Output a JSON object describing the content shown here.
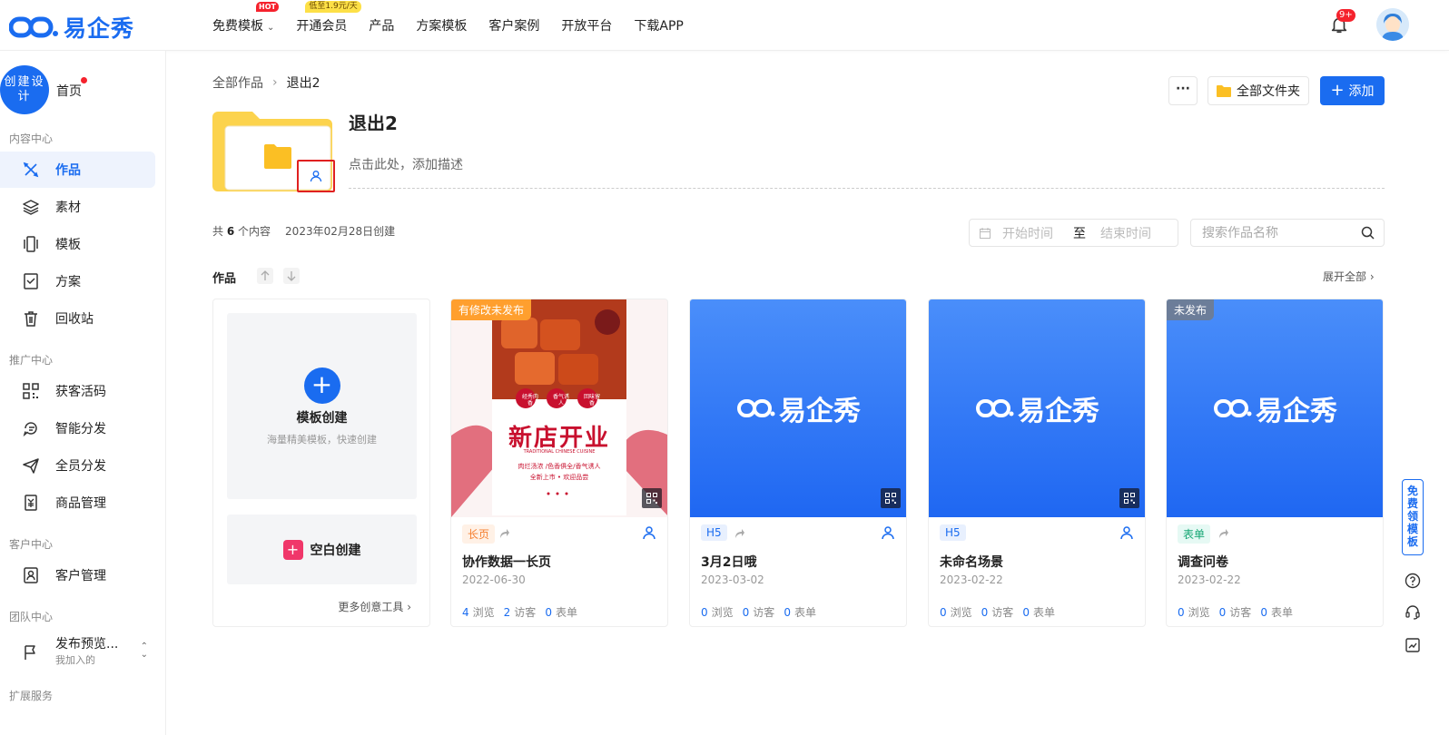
{
  "app": {
    "logo_text": "易企秀"
  },
  "nav": {
    "items": [
      {
        "label": "免费模板",
        "badge": "HOT"
      },
      {
        "label": "开通会员",
        "badge": "低至1.9元/天"
      },
      {
        "label": "产品"
      },
      {
        "label": "方案模板"
      },
      {
        "label": "客户案例"
      },
      {
        "label": "开放平台"
      },
      {
        "label": "下载APP"
      }
    ],
    "notification_count": "9+"
  },
  "sidebar": {
    "create_label": "创建设计",
    "home_label": "首页",
    "groups": [
      {
        "title": "内容中心"
      },
      {
        "title": "推广中心"
      },
      {
        "title": "客户中心"
      },
      {
        "title": "团队中心"
      },
      {
        "title": "扩展服务"
      }
    ],
    "items": [
      {
        "label": "作品",
        "icon": "tools-icon",
        "active": true
      },
      {
        "label": "素材",
        "icon": "layers-icon"
      },
      {
        "label": "模板",
        "icon": "template-icon"
      },
      {
        "label": "方案",
        "icon": "checklist-icon"
      },
      {
        "label": "回收站",
        "icon": "trash-icon"
      },
      {
        "label": "获客活码",
        "icon": "qrcode-icon"
      },
      {
        "label": "智能分发",
        "icon": "smart-distribute-icon"
      },
      {
        "label": "全员分发",
        "icon": "paper-plane-icon"
      },
      {
        "label": "商品管理",
        "icon": "product-icon"
      },
      {
        "label": "客户管理",
        "icon": "contact-card-icon"
      },
      {
        "label": "发布预览...",
        "sub": "我加入的",
        "icon": "flag-icon"
      }
    ]
  },
  "breadcrumb": {
    "root": "全部作品",
    "current": "退出2"
  },
  "toolbar": {
    "more_label": "···",
    "all_folders_label": "全部文件夹",
    "add_label": "添加"
  },
  "folder": {
    "title": "退出2",
    "desc_placeholder": "点击此处，添加描述",
    "count_prefix": "共",
    "count": "6",
    "count_suffix": "个内容",
    "created": "2023年02月28日创建"
  },
  "filters": {
    "start_placeholder": "开始时间",
    "to_label": "至",
    "end_placeholder": "结束时间",
    "search_placeholder": "搜索作品名称"
  },
  "section": {
    "title": "作品",
    "expand_label": "展开全部"
  },
  "create_card": {
    "template_title": "模板创建",
    "template_sub": "海量精美模板，快速创建",
    "blank_title": "空白创建",
    "more_tools": "更多创意工具"
  },
  "cards": [
    {
      "tag": "有修改未发布",
      "tag_style": "orange",
      "type": "长页",
      "type_style": "page",
      "title": "协作数据一长页",
      "date": "2022-06-30",
      "views": "4",
      "visitors": "2",
      "forms": "0",
      "cover": "poster",
      "poster": {
        "headline": "新店开业",
        "en": "TRADITIONAL CHINESE CUISINE",
        "line1": "肉烂汤浓 /色香俱全/香气诱人",
        "line2": "全新上市 • 欢迎品尝",
        "circles": [
          "经秀肉香",
          "香气诱人",
          "回味留香"
        ]
      }
    },
    {
      "tag": "",
      "tag_style": "",
      "type": "H5",
      "type_style": "h5",
      "title": "3月2日哦",
      "date": "2023-03-02",
      "views": "0",
      "visitors": "0",
      "forms": "0",
      "cover": "logo",
      "logo_text": "易企秀"
    },
    {
      "tag": "",
      "tag_style": "",
      "type": "H5",
      "type_style": "h5",
      "title": "未命名场景",
      "date": "2023-02-22",
      "views": "0",
      "visitors": "0",
      "forms": "0",
      "cover": "logo",
      "logo_text": "易企秀"
    },
    {
      "tag": "未发布",
      "tag_style": "gray",
      "type": "表单",
      "type_style": "form",
      "title": "调查问卷",
      "date": "2023-02-22",
      "views": "0",
      "visitors": "0",
      "forms": "0",
      "cover": "logo",
      "logo_text": "易企秀"
    }
  ],
  "stats_labels": {
    "views": "浏览",
    "visitors": "访客",
    "forms": "表单"
  },
  "float_bar": {
    "free_template": "免费领模板"
  },
  "colors": {
    "brand": "#1a6cf0",
    "danger": "#f5222d"
  }
}
